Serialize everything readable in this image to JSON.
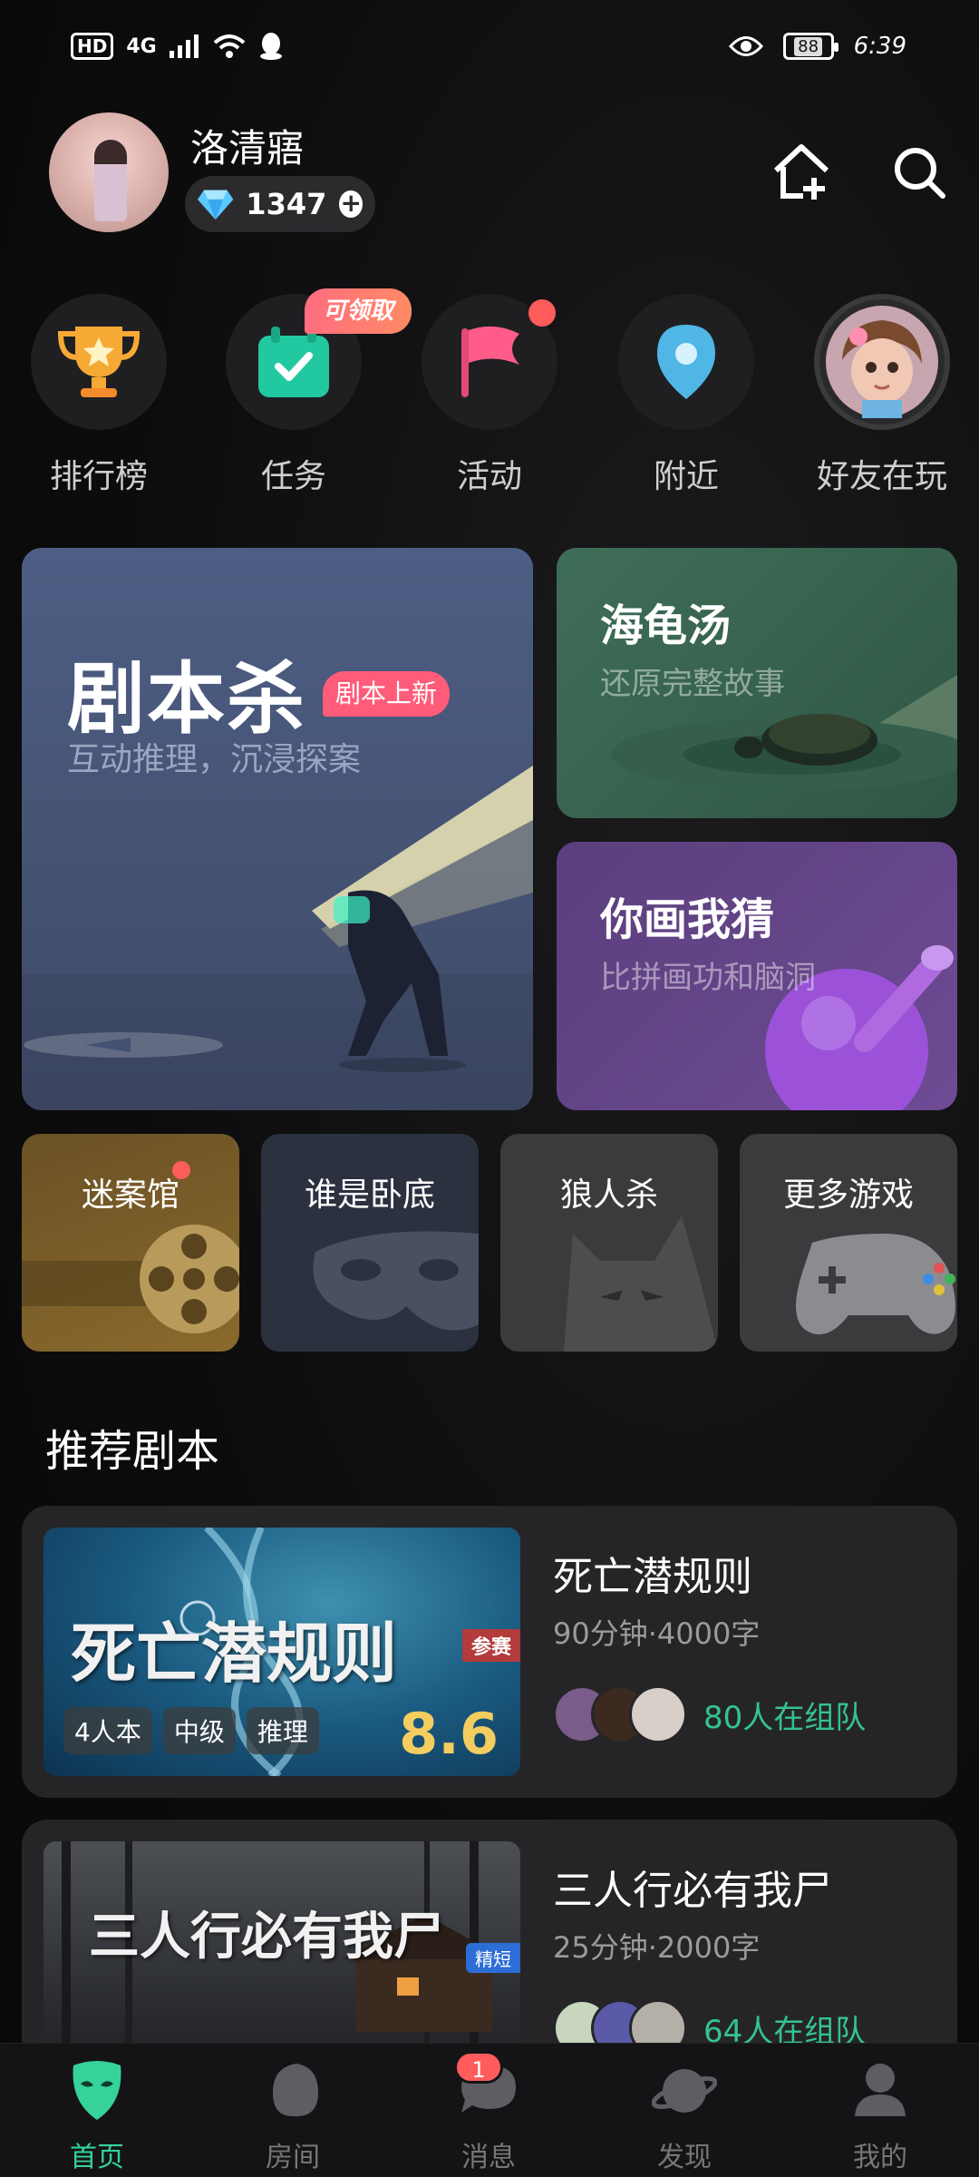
{
  "status_bar": {
    "hd": "HD",
    "network": "4G",
    "battery": "88",
    "time": "6:39"
  },
  "header": {
    "username": "洛清寤",
    "diamonds": "1347"
  },
  "shortcuts": [
    {
      "label": "排行榜",
      "icon": "trophy-icon"
    },
    {
      "label": "任务",
      "icon": "task-calendar-icon",
      "badge": "可领取"
    },
    {
      "label": "活动",
      "icon": "flag-icon",
      "dot": true
    },
    {
      "label": "附近",
      "icon": "location-pin-icon"
    },
    {
      "label": "好友在玩",
      "icon": "friend-avatar"
    }
  ],
  "games": {
    "jubensha": {
      "title": "剧本杀",
      "badge": "剧本上新",
      "subtitle": "互动推理，沉浸探案"
    },
    "haigui": {
      "title": "海龟汤",
      "subtitle": "还原完整故事"
    },
    "nihua": {
      "title": "你画我猜",
      "subtitle": "比拼画功和脑洞"
    }
  },
  "tiles": [
    {
      "label": "迷案馆",
      "dot": true
    },
    {
      "label": "谁是卧底"
    },
    {
      "label": "狼人杀"
    },
    {
      "label": "更多游戏"
    }
  ],
  "section_title": "推荐剧本",
  "scripts": [
    {
      "title": "死亡潜规则",
      "meta": "90分钟·4000字",
      "tags": [
        "4人本",
        "中级",
        "推理"
      ],
      "score": "8.6",
      "ribbon": "参赛",
      "team": "80人在组队"
    },
    {
      "title": "三人行必有我尸",
      "meta": "25分钟·2000字",
      "ribbon": "精短",
      "team": "64人在组队"
    }
  ],
  "nav": [
    {
      "label": "首页",
      "active": true
    },
    {
      "label": "房间"
    },
    {
      "label": "消息",
      "badge": "1"
    },
    {
      "label": "发现"
    },
    {
      "label": "我的"
    }
  ],
  "colors": {
    "accent": "#35d29a",
    "badge_red": "#ff5c5c",
    "score_gold": "#f3cd5f"
  }
}
